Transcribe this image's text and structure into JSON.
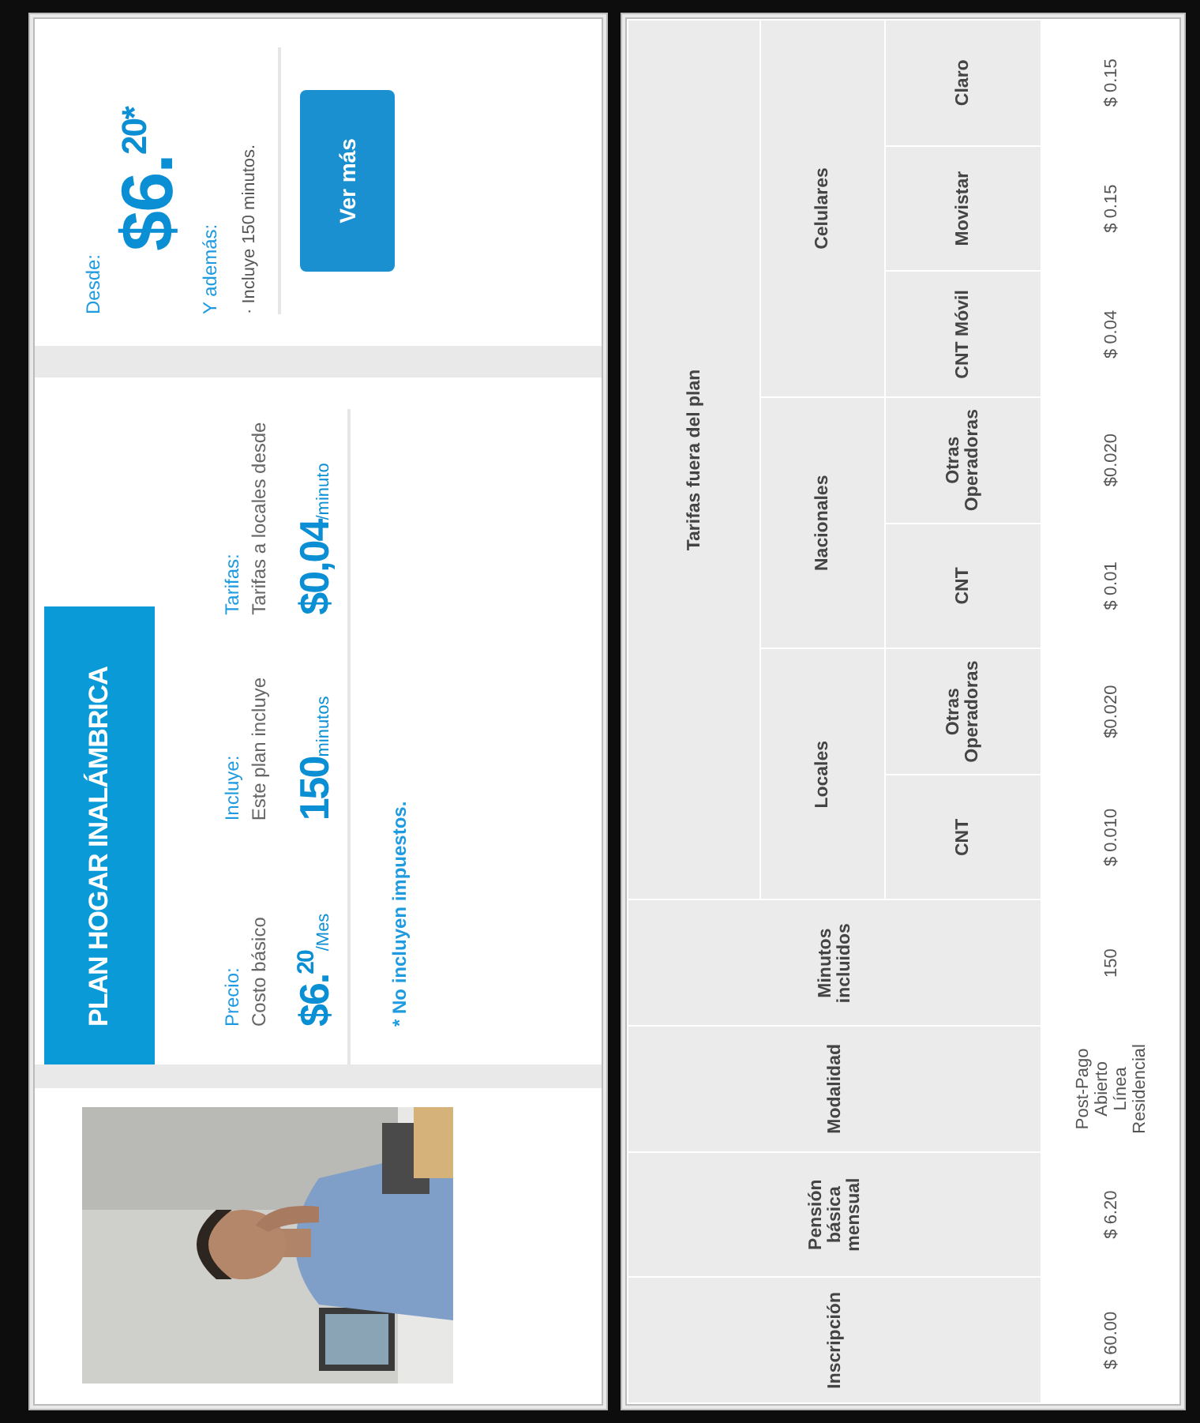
{
  "plan_card": {
    "title": "PLAN HOGAR INALÁMBRICA",
    "columns": [
      {
        "label": "Precio:",
        "description": "Costo básico",
        "amount": "$6.$^{20}$",
        "unit": "/Mes"
      },
      {
        "label": "Incluye:",
        "description": "Este plan incluye",
        "amount": "150",
        "unit": "minutos"
      },
      {
        "label": "Tarifas:",
        "description": "Tarifas a locales desde",
        "amount": "$0,04",
        "unit": "/minuto"
      }
    ],
    "footnote": "* No incluyen impuestos."
  },
  "offer": {
    "from_label": "Desde:",
    "price": "$6.$^{20*}$",
    "also_label": "Y además:",
    "bullets": [
      "· Incluye 150 minutos."
    ],
    "button": "Ver más"
  },
  "rate_table": {
    "columns": [
      {
        "label": "Inscripción"
      },
      {
        "label": "Pensión básica mensual"
      },
      {
        "label": "Modalidad"
      },
      {
        "label": "Minutos incluidos"
      },
      {
        "label": "Tarifas fuera del plan",
        "children": [
          {
            "label": "Locales",
            "children": [
              {
                "label": "CNT"
              },
              {
                "label": "Otras Operadoras"
              }
            ]
          },
          {
            "label": "Nacionales",
            "children": [
              {
                "label": "CNT"
              },
              {
                "label": "Otras Operadoras"
              }
            ]
          },
          {
            "label": "Celulares",
            "children": [
              {
                "label": "CNT Móvil"
              },
              {
                "label": "Movistar"
              },
              {
                "label": "Claro"
              }
            ]
          }
        ]
      }
    ],
    "plan_values": [
      "$ 60.00",
      "$ 6.20",
      "Post-Pago Abierto Línea Residencial",
      "150",
      "$ 0.010",
      "$0.020",
      "$ 0.01",
      "$0.020",
      "$ 0.04",
      "$ 0.15",
      "$ 0.15"
    ]
  }
}
